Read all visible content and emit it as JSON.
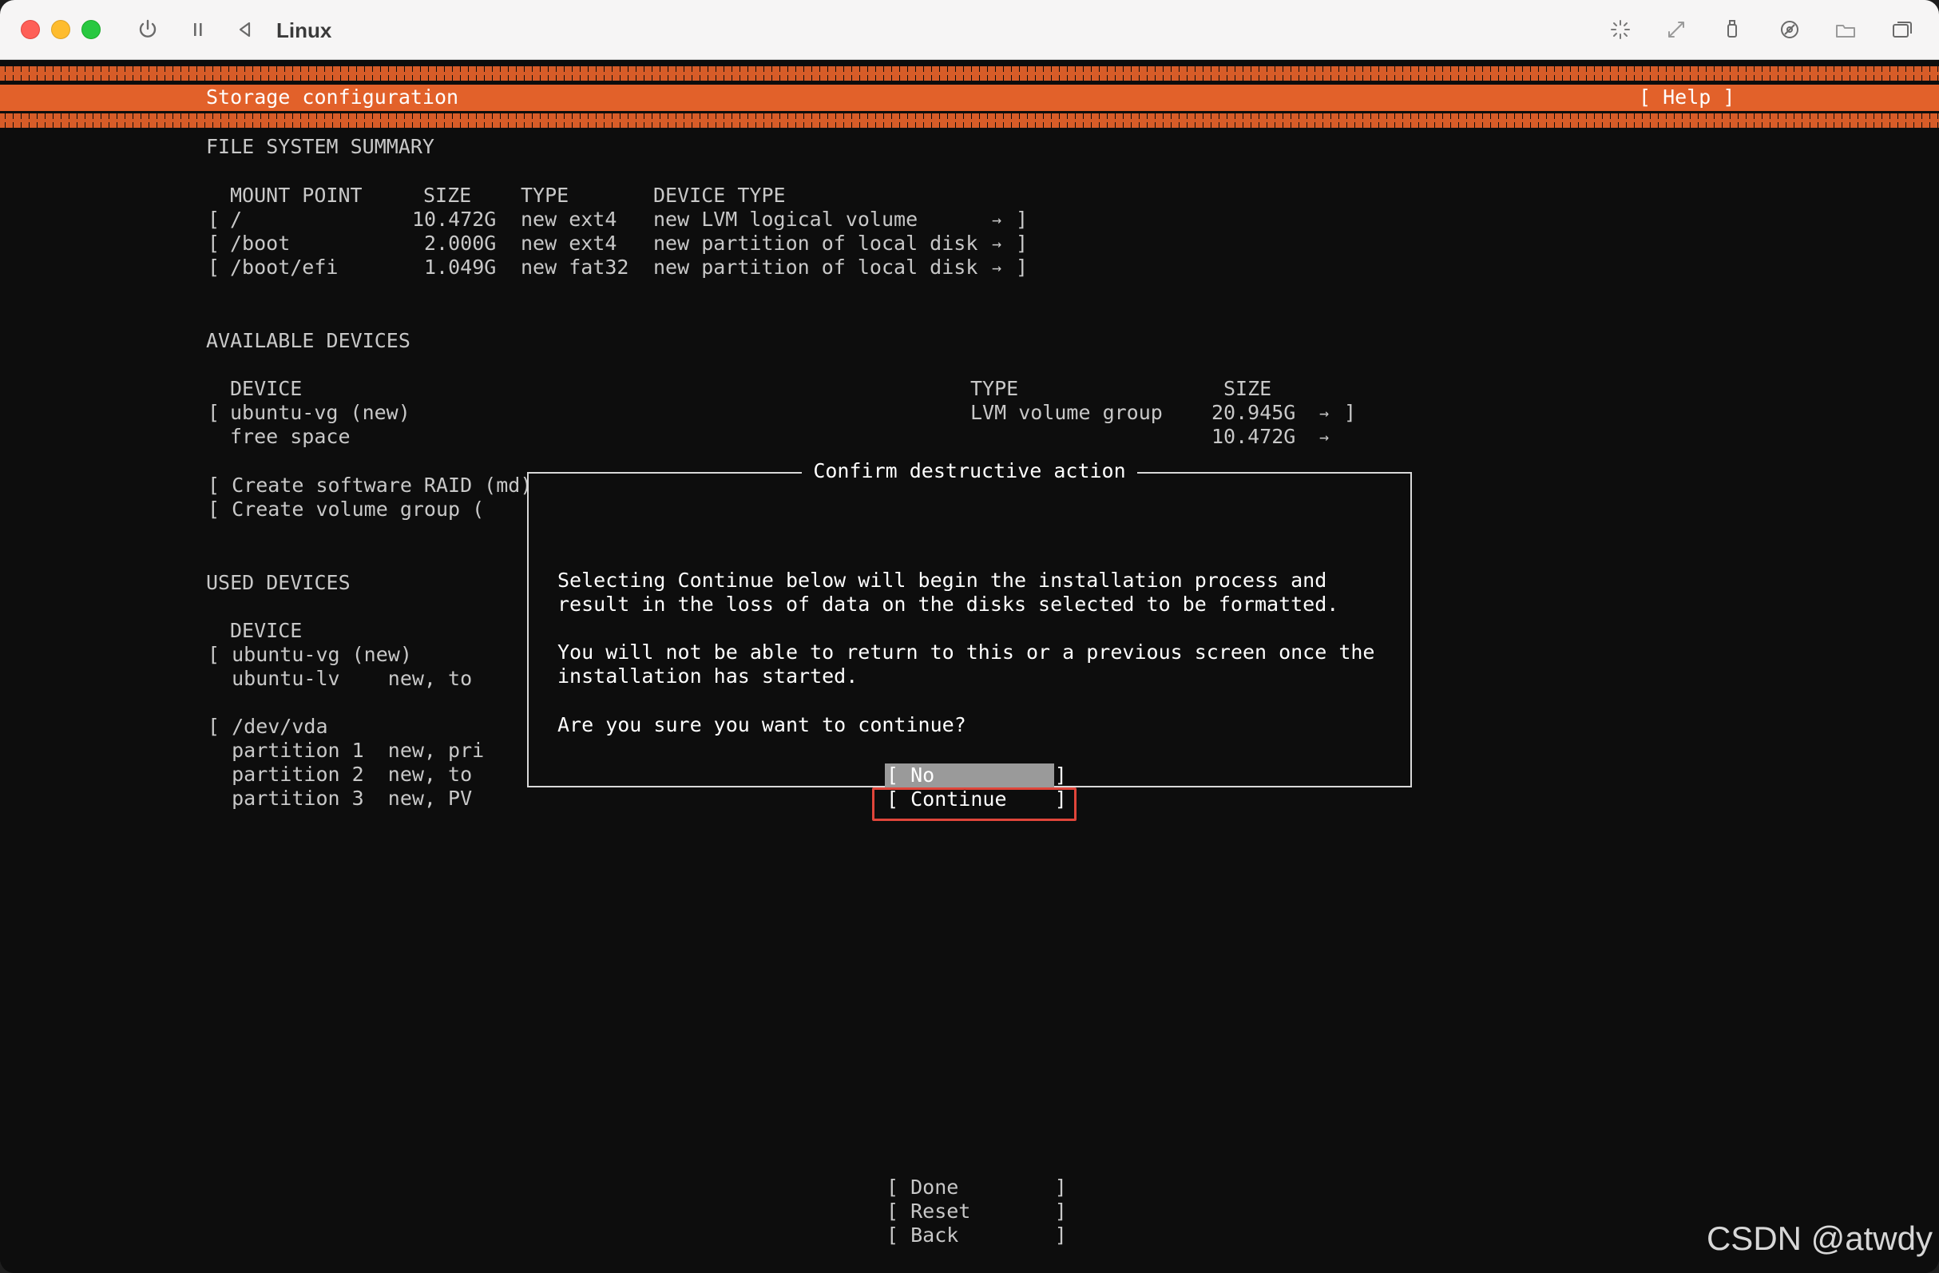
{
  "window": {
    "title": "Linux"
  },
  "header": {
    "title": "Storage configuration",
    "help_label": "[ Help ]"
  },
  "fs_summary": {
    "heading": "FILE SYSTEM SUMMARY",
    "columns": [
      "MOUNT POINT",
      "SIZE",
      "TYPE",
      "DEVICE TYPE"
    ],
    "rows": [
      {
        "open": "[",
        "mount": "/",
        "size": "10.472G",
        "type": "new ext4",
        "device_type": "new LVM logical volume",
        "arrow": "→",
        "close": "]"
      },
      {
        "open": "[",
        "mount": "/boot",
        "size": "2.000G",
        "type": "new ext4",
        "device_type": "new partition of local disk",
        "arrow": "→",
        "close": "]"
      },
      {
        "open": "[",
        "mount": "/boot/efi",
        "size": "1.049G",
        "type": "new fat32",
        "device_type": "new partition of local disk",
        "arrow": "→",
        "close": "]"
      }
    ]
  },
  "available": {
    "heading": "AVAILABLE DEVICES",
    "columns": [
      "DEVICE",
      "TYPE",
      "SIZE"
    ],
    "rows": [
      {
        "open": "[",
        "device": "ubuntu-vg (new)",
        "type": "LVM volume group",
        "size": "20.945G",
        "arrow": "→",
        "close": "]"
      },
      {
        "open": "",
        "device": "free space",
        "type": "",
        "size": "10.472G",
        "arrow": "→",
        "close": ""
      }
    ],
    "actions": [
      "[ Create software RAID (md) → ]",
      "[ Create volume group ("
    ]
  },
  "used": {
    "heading": "USED DEVICES",
    "column": "DEVICE",
    "lines": [
      "[ ubuntu-vg (new)",
      "  ubuntu-lv    new, to",
      "",
      "[ /dev/vda",
      "  partition 1  new, pri",
      "  partition 2  new, to",
      "  partition 3  new, PV"
    ]
  },
  "dialog": {
    "title": "Confirm destructive action",
    "lines": [
      "Selecting Continue below will begin the installation process and",
      "result in the loss of data on the disks selected to be formatted.",
      "",
      "You will not be able to return to this or a previous screen once the",
      "installation has started.",
      "",
      "Are you sure you want to continue?"
    ],
    "no_label": "[ No          ]",
    "continue_label": "[ Continue    ]"
  },
  "footer": {
    "done_label": "[ Done        ]",
    "reset_label": "[ Reset       ]",
    "back_label": "[ Back        ]"
  },
  "watermark": "CSDN @atwdy",
  "colors": {
    "accent_orange": "#e2612a",
    "highlight_red": "#e0453a",
    "selected_button_bg": "#9a9a9a"
  }
}
